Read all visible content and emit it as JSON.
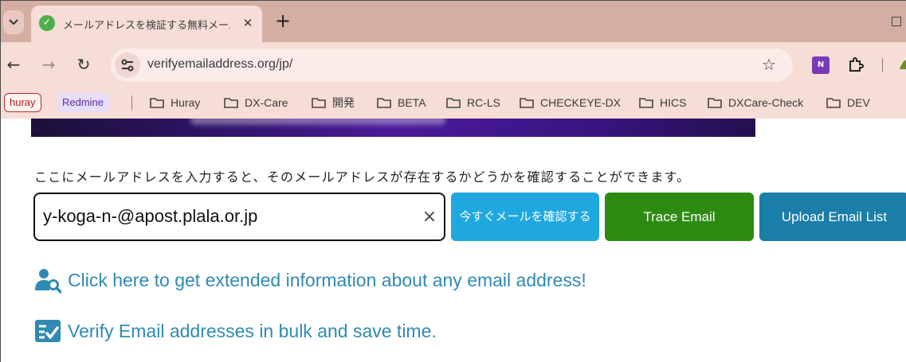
{
  "browser": {
    "tab_title": "メールアドレスを検証する無料メール",
    "favicon_glyph": "✓",
    "new_tab_glyph": "+",
    "close_glyph": "✕",
    "url": "verifyemailaddress.org/jp/",
    "nav": {
      "back": "←",
      "forward": "→",
      "reload": "↻"
    },
    "star_glyph": "☆",
    "extensions": {
      "onenote_label": "N"
    }
  },
  "bookmarks": {
    "chips": [
      "huray",
      "Redmine"
    ],
    "folders": [
      "Huray",
      "DX-Care",
      "開発",
      "BETA",
      "RC-LS",
      "CHECKEYE-DX",
      "HICS",
      "DXCare-Check",
      "DEV"
    ]
  },
  "page": {
    "intro_text": "ここにメールアドレスを入力すると、そのメールアドレスが存在するかどうかを確認することができます。",
    "email_value": "y-koga-n-@apost.plala.or.jp",
    "clear_glyph": "×",
    "verify_button": "今すぐメールを確認する",
    "trace_button": "Trace Email",
    "upload_button": "Upload Email List",
    "link_extended": "Click here to get extended information about any email address!",
    "link_bulk": "Verify Email addresses in bulk and save time."
  },
  "colors": {
    "chrome": "#d5aea3",
    "verify": "#1fa8df",
    "trace": "#2e8b12",
    "upload": "#1a7ea8",
    "link": "#2f8ab3"
  }
}
